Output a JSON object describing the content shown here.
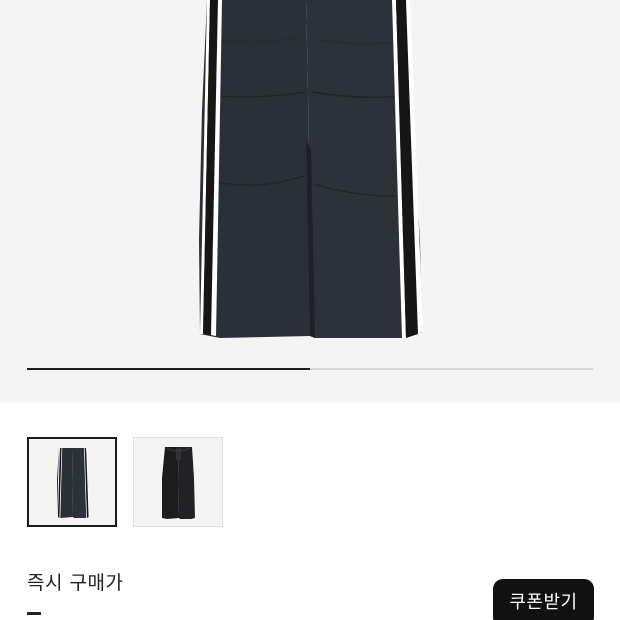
{
  "gallery": {
    "image_count": 2,
    "current_index": 1,
    "progress": 0.5,
    "progress_color": "#1f1f1f",
    "track_color": "#d6d6d6",
    "images": [
      {
        "name": "product-image-navy-track-pants",
        "selected": true
      },
      {
        "name": "product-image-black-track-pants",
        "selected": false
      }
    ]
  },
  "colors": {
    "pants_main": "#2b3038",
    "pants_stripe_dark": "#161616",
    "pants_stripe_white": "#ffffff",
    "background": "#f4f4f4",
    "button_bg": "#111111"
  },
  "purchase": {
    "label": "즉시 구매가"
  },
  "coupon": {
    "label": "쿠폰받기"
  }
}
